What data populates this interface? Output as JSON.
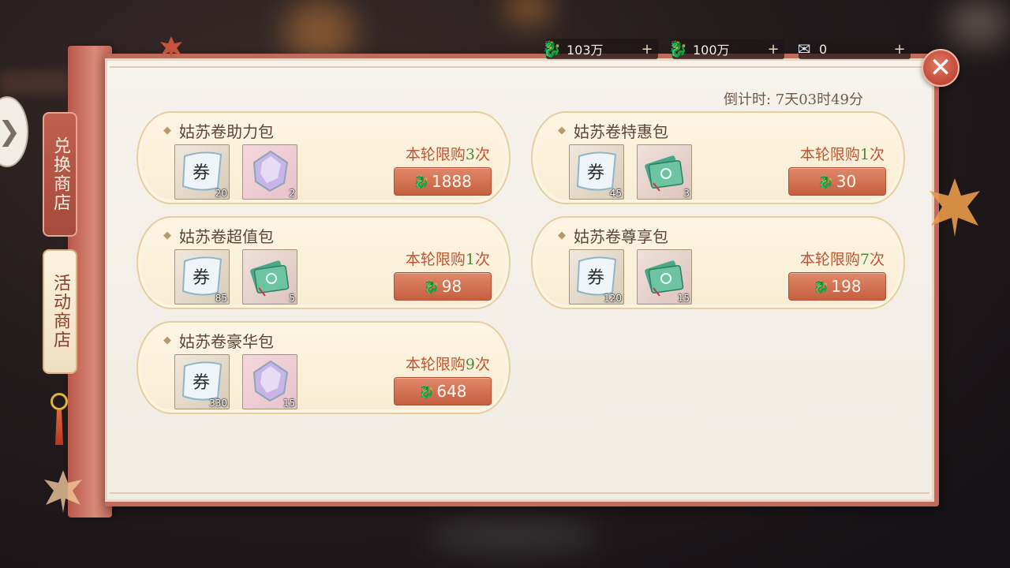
{
  "currencies": [
    {
      "icon": "gold-dragon-icon",
      "value": "103万",
      "color": "#e6c76a"
    },
    {
      "icon": "jade-dragon-icon",
      "value": "100万",
      "color": "#5ec7a0"
    },
    {
      "icon": "ticket-icon",
      "value": "0",
      "color": "#dfe7ee"
    }
  ],
  "countdown": "倒计时: 7天03时49分",
  "tabs": [
    {
      "label": "兑换商店",
      "active": false
    },
    {
      "label": "活动商店",
      "active": true
    }
  ],
  "packs": [
    {
      "title": "姑苏卷助力包",
      "items": [
        {
          "type": "ticket",
          "count": "20"
        },
        {
          "type": "gem",
          "count": "2"
        }
      ],
      "limit_prefix": "本轮限购",
      "limit_n": "3",
      "limit_suffix": "次",
      "price_icon": "gold-dragon-icon",
      "price": "1888"
    },
    {
      "title": "姑苏卷特惠包",
      "items": [
        {
          "type": "ticket",
          "count": "45"
        },
        {
          "type": "note",
          "count": "3"
        }
      ],
      "limit_prefix": "本轮限购",
      "limit_n": "1",
      "limit_suffix": "次",
      "price_icon": "jade-dragon-icon",
      "price": "30"
    },
    {
      "title": "姑苏卷超值包",
      "items": [
        {
          "type": "ticket",
          "count": "85"
        },
        {
          "type": "note",
          "count": "5"
        }
      ],
      "limit_prefix": "本轮限购",
      "limit_n": "1",
      "limit_suffix": "次",
      "price_icon": "jade-dragon-icon",
      "price": "98"
    },
    {
      "title": "姑苏卷尊享包",
      "items": [
        {
          "type": "ticket",
          "count": "120"
        },
        {
          "type": "note",
          "count": "15"
        }
      ],
      "limit_prefix": "本轮限购",
      "limit_n": "7",
      "limit_suffix": "次",
      "price_icon": "jade-dragon-icon",
      "price": "198"
    },
    {
      "title": "姑苏卷豪华包",
      "items": [
        {
          "type": "ticket",
          "count": "330"
        },
        {
          "type": "gem",
          "count": "15"
        }
      ],
      "limit_prefix": "本轮限购",
      "limit_n": "9",
      "limit_suffix": "次",
      "price_icon": "jade-dragon-icon",
      "price": "648"
    }
  ],
  "close_icon": "close-icon",
  "nav_icon": "chevron-right-icon"
}
